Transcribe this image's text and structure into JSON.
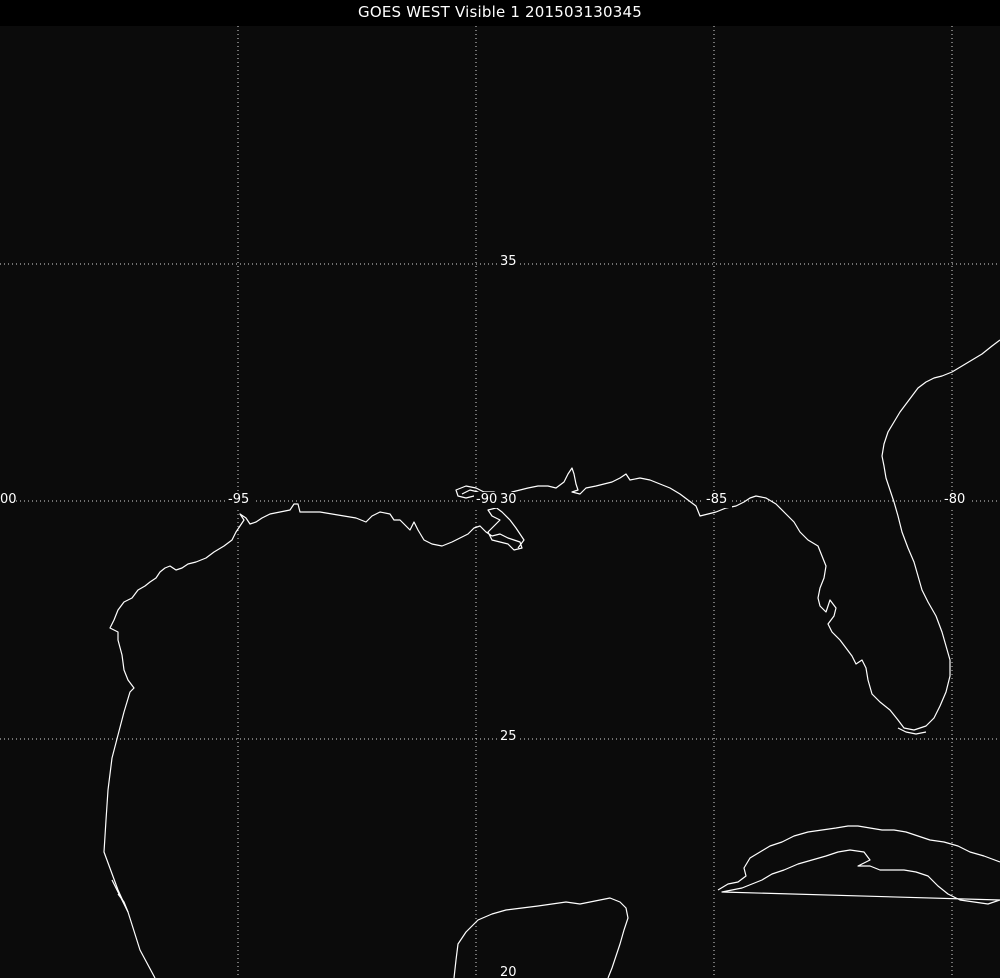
{
  "title": "GOES WEST Visible 1 201503130345",
  "longitude_labels": [
    "00",
    "-95",
    "-90",
    "-85",
    "-80"
  ],
  "latitude_labels": [
    "35",
    "30",
    "25",
    "20"
  ],
  "colors": {
    "background": "#0b0b0b",
    "coastline": "#ffffff",
    "grid": "#d8d8d8",
    "text": "#ffffff"
  }
}
